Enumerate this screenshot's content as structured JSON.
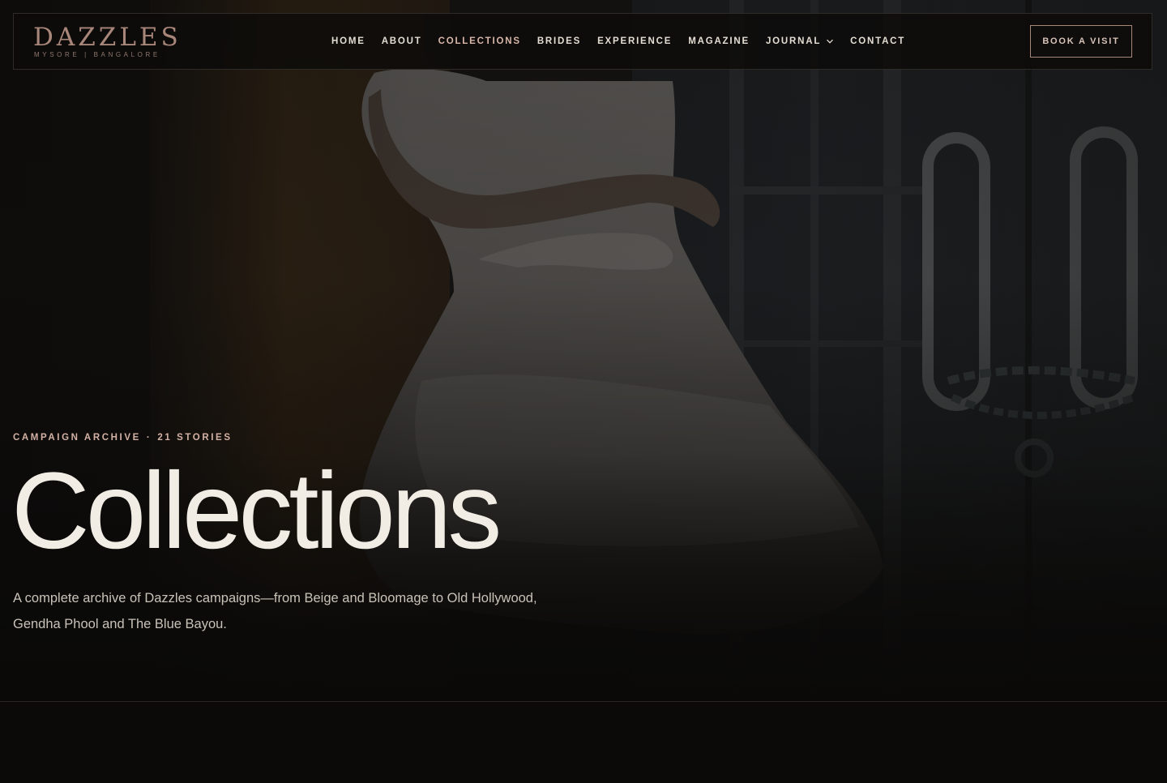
{
  "brand": {
    "name": "DAZZLES",
    "tagline": "MYSORE | BANGALORE"
  },
  "nav": {
    "items": [
      {
        "label": "HOME"
      },
      {
        "label": "ABOUT"
      },
      {
        "label": "COLLECTIONS",
        "active": true
      },
      {
        "label": "BRIDES"
      },
      {
        "label": "EXPERIENCE"
      },
      {
        "label": "MAGAZINE"
      },
      {
        "label": "JOURNAL",
        "has_dropdown": true,
        "icon": "chevron-down-icon"
      },
      {
        "label": "CONTACT"
      }
    ],
    "cta_label": "BOOK A VISIT"
  },
  "hero": {
    "eyebrow": {
      "section": "CAMPAIGN ARCHIVE",
      "separator": "·",
      "count": "21 STORIES"
    },
    "title": "Collections",
    "description": "A complete archive of Dazzles campaigns—from Beige and Bloomage to Old Hollywood, Gendha Phool and The Blue Bayou."
  },
  "colors": {
    "background": "#0b0a09",
    "accent": "#a9867a",
    "accent_light": "#d8b7a8",
    "title_text": "#f2ede4",
    "body_text": "#c9c2b8",
    "nav_text": "#e4ddd3"
  }
}
